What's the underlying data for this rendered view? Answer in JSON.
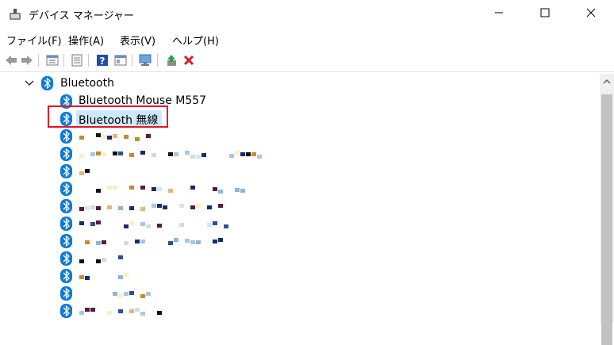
{
  "window": {
    "title": "デバイス マネージャー",
    "minimize_icon": "minimize-icon",
    "maximize_icon": "maximize-icon",
    "close_icon": "close-icon"
  },
  "menu": {
    "file": "ファイル(F)",
    "action": "操作(A)",
    "view": "表示(V)",
    "help": "ヘルプ(H)"
  },
  "toolbar": {
    "icons": [
      "back-icon",
      "forward-icon",
      "properties-icon",
      "print-icon",
      "help-icon",
      "view-icon",
      "monitor-icon",
      "update-driver-icon",
      "uninstall-icon"
    ]
  },
  "tree": {
    "category_label": "Bluetooth",
    "devices": [
      {
        "label": "Bluetooth Mouse M557"
      },
      {
        "label": "Bluetooth 無線"
      }
    ]
  },
  "colors": {
    "bluetooth_blue": "#0a7bd9",
    "selection": "#cce8ff",
    "highlight_box": "#e81123"
  }
}
